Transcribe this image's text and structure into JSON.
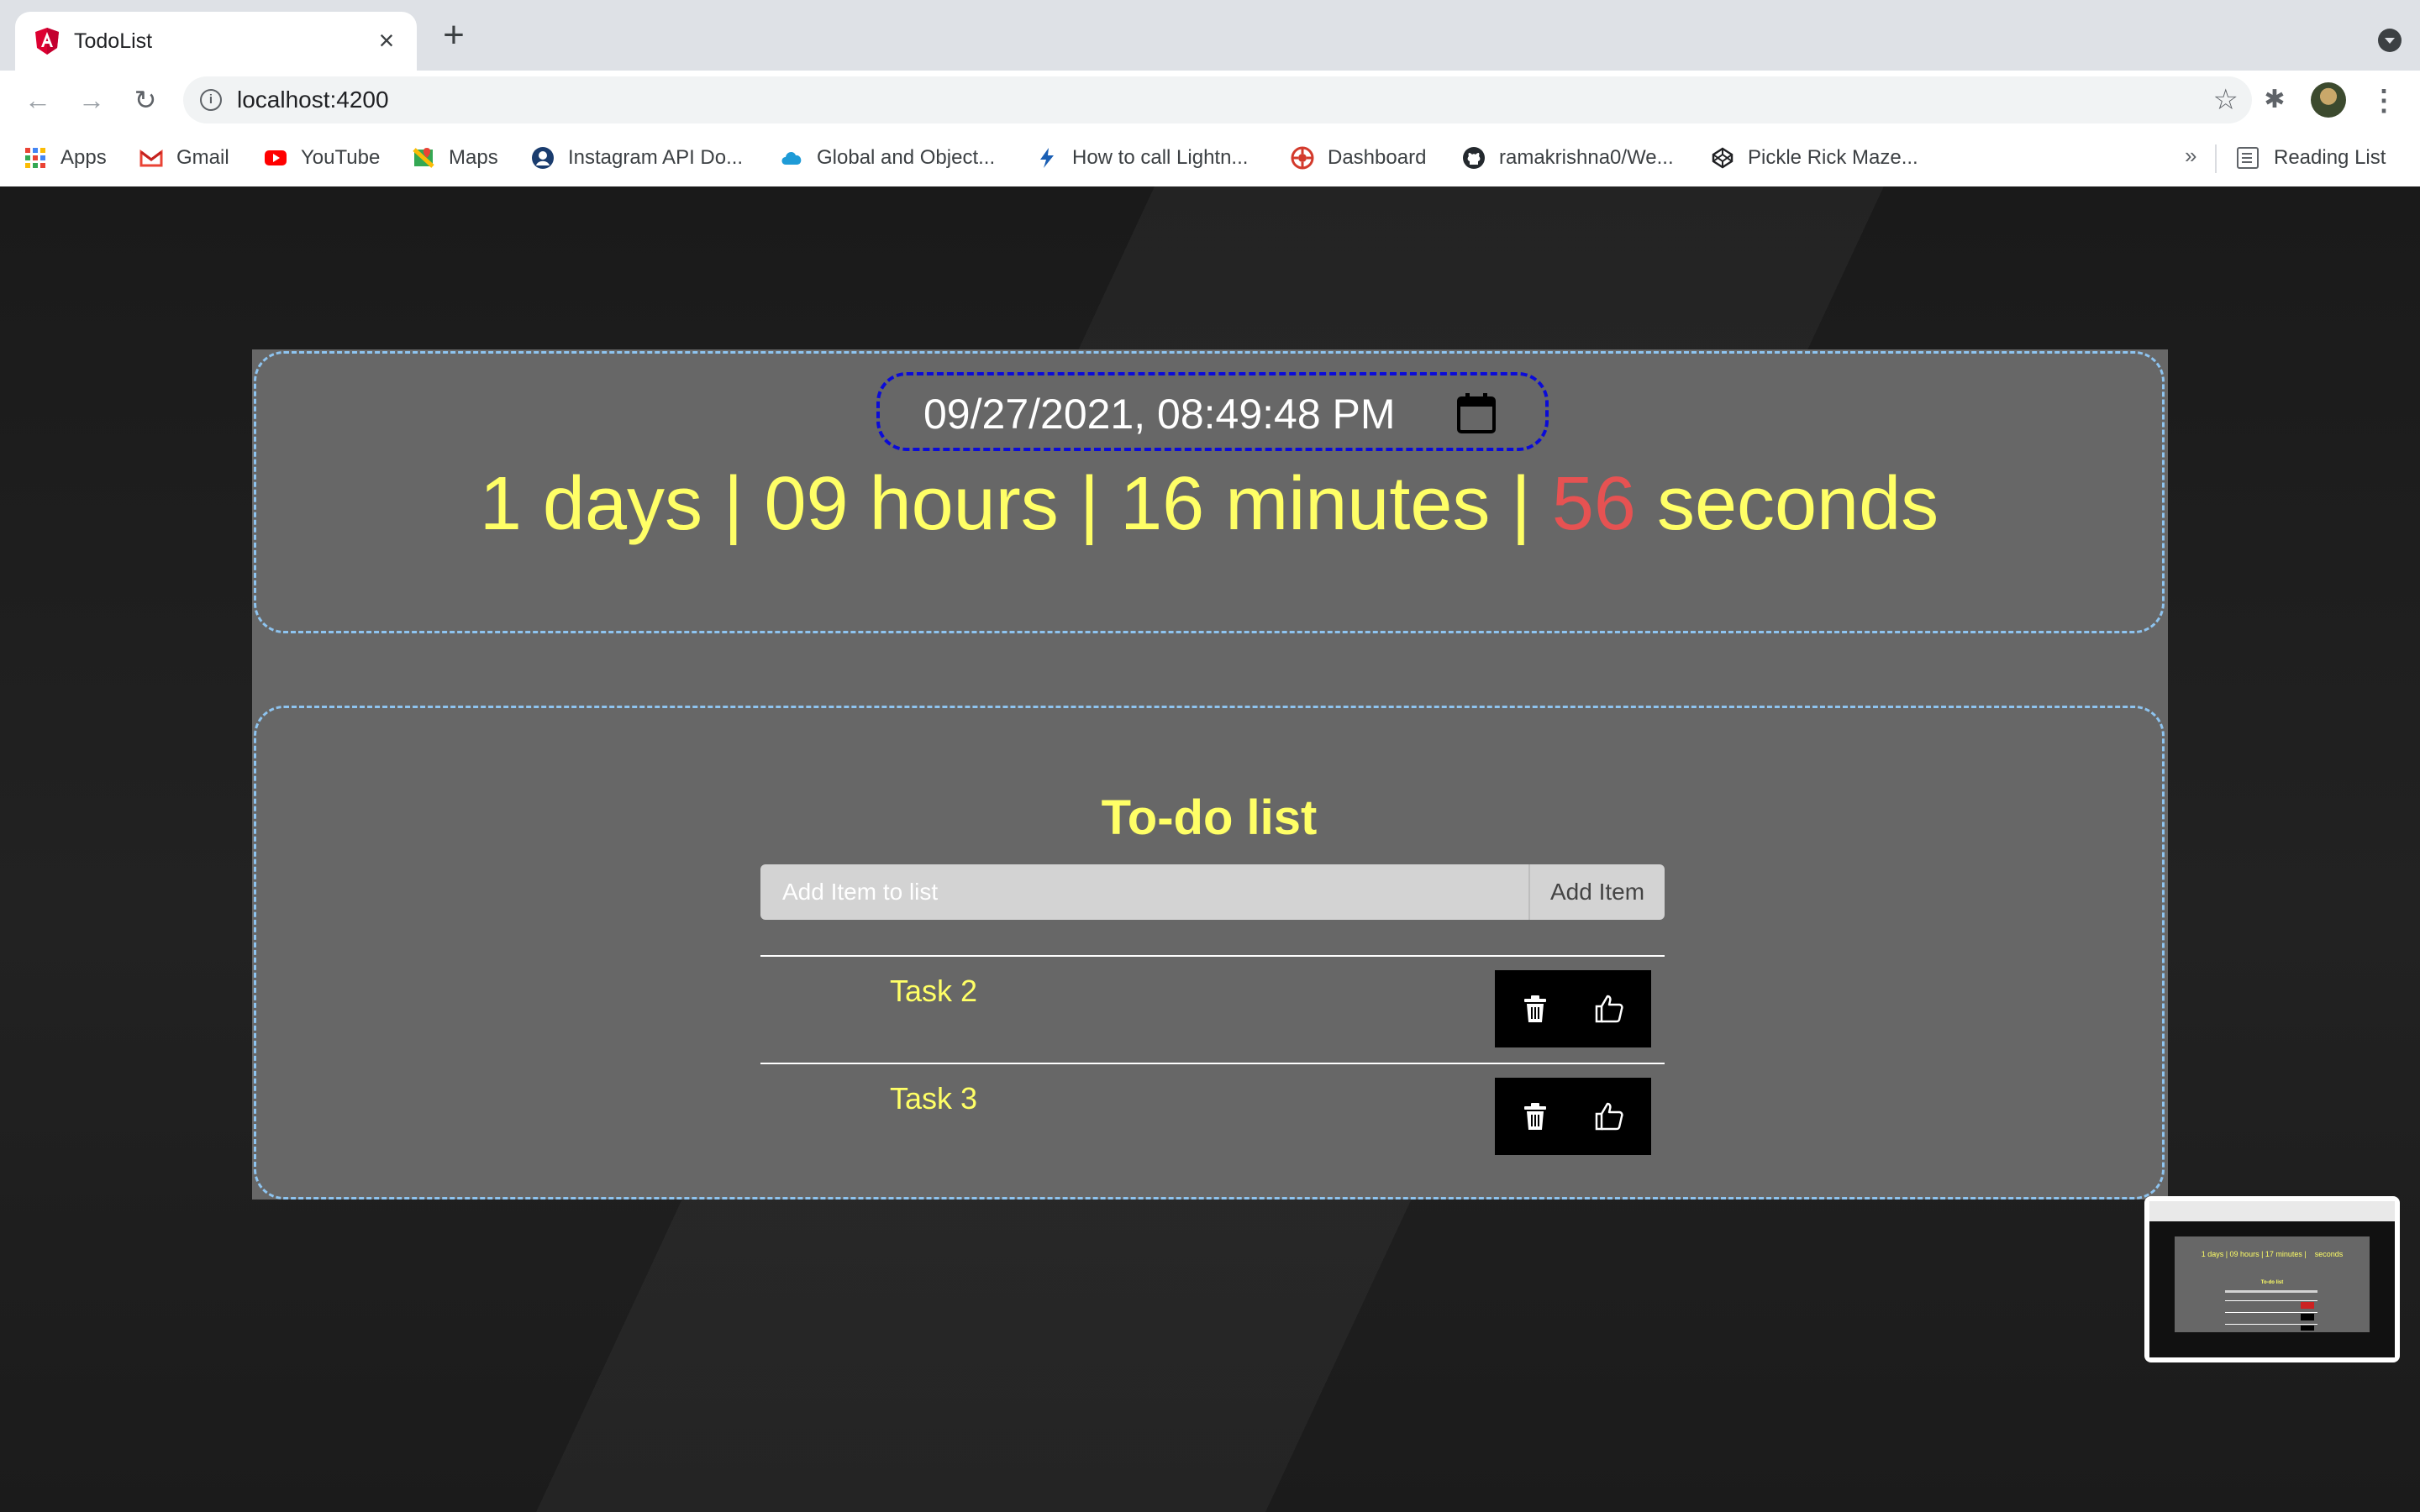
{
  "browser": {
    "tab_title": "TodoList",
    "url": "localhost:4200",
    "bookmarks": [
      {
        "label": "Apps",
        "icon": "apps-grid-icon",
        "color": "#ea4335"
      },
      {
        "label": "Gmail",
        "icon": "gmail-icon",
        "color": "#ea4335"
      },
      {
        "label": "YouTube",
        "icon": "youtube-icon",
        "color": "#ff0000"
      },
      {
        "label": "Maps",
        "icon": "maps-icon",
        "color": "#34a853"
      },
      {
        "label": "Instagram API Do...",
        "icon": "instagram-api-icon",
        "color": "#1a3c6e"
      },
      {
        "label": "Global and Object...",
        "icon": "salesforce-cloud-icon",
        "color": "#1e9bd7"
      },
      {
        "label": "How to call Lightn...",
        "icon": "lightning-icon",
        "color": "#1a5fb4"
      },
      {
        "label": "Dashboard",
        "icon": "dashboard-icon",
        "color": "#d33a2c"
      },
      {
        "label": "ramakrishna0/We...",
        "icon": "github-icon",
        "color": "#24292e"
      },
      {
        "label": "Pickle Rick Maze...",
        "icon": "codepen-icon",
        "color": "#202124"
      }
    ],
    "reading_list": "Reading List"
  },
  "timer": {
    "datetime_value": "09/27/2021, 08:49:48 PM",
    "days": "1",
    "days_unit": "days",
    "hours": "09",
    "hours_unit": "hours",
    "minutes": "16",
    "minutes_unit": "minutes",
    "seconds": "56",
    "seconds_unit": "seconds",
    "separator": "|",
    "text_color": "#ffff66",
    "seconds_color": "#e65252"
  },
  "todo": {
    "title": "To-do list",
    "input_placeholder": "Add Item to list",
    "add_button": "Add Item",
    "tasks": [
      {
        "label": "Task 2"
      },
      {
        "label": "Task 3"
      }
    ]
  },
  "thumbnail": {
    "countdown_text": "1 days | 09 hours | 17 minutes |    seconds",
    "title": "To-do list"
  }
}
